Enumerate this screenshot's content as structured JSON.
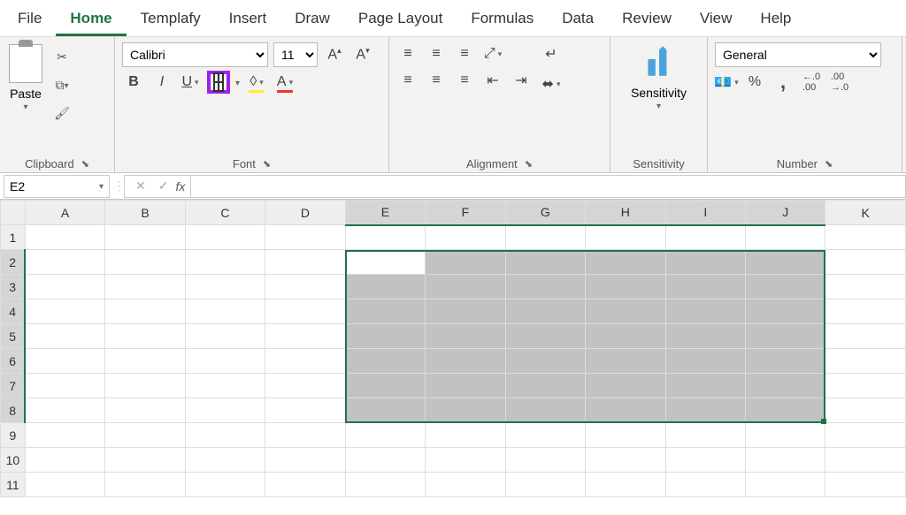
{
  "menu": {
    "file": "File",
    "home": "Home",
    "templafy": "Templafy",
    "insert": "Insert",
    "draw": "Draw",
    "page_layout": "Page Layout",
    "formulas": "Formulas",
    "data": "Data",
    "review": "Review",
    "view": "View",
    "help": "Help"
  },
  "ribbon": {
    "clipboard": {
      "paste": "Paste",
      "label": "Clipboard"
    },
    "font": {
      "name": "Calibri",
      "size": "11",
      "label": "Font"
    },
    "alignment": {
      "label": "Alignment"
    },
    "sensitivity": {
      "title": "Sensitivity",
      "label": "Sensitivity"
    },
    "number": {
      "format": "General",
      "label": "Number"
    }
  },
  "formula_bar": {
    "name_box": "E2",
    "fx": "fx",
    "value": ""
  },
  "grid": {
    "columns": [
      "A",
      "B",
      "C",
      "D",
      "E",
      "F",
      "G",
      "H",
      "I",
      "J",
      "K"
    ],
    "rows": [
      "1",
      "2",
      "3",
      "4",
      "5",
      "6",
      "7",
      "8",
      "9",
      "10",
      "11"
    ],
    "selection": {
      "start_col": "E",
      "end_col": "J",
      "start_row": "2",
      "end_row": "8",
      "active_cell": "E2"
    }
  },
  "highlight": {
    "borders_button": true
  }
}
